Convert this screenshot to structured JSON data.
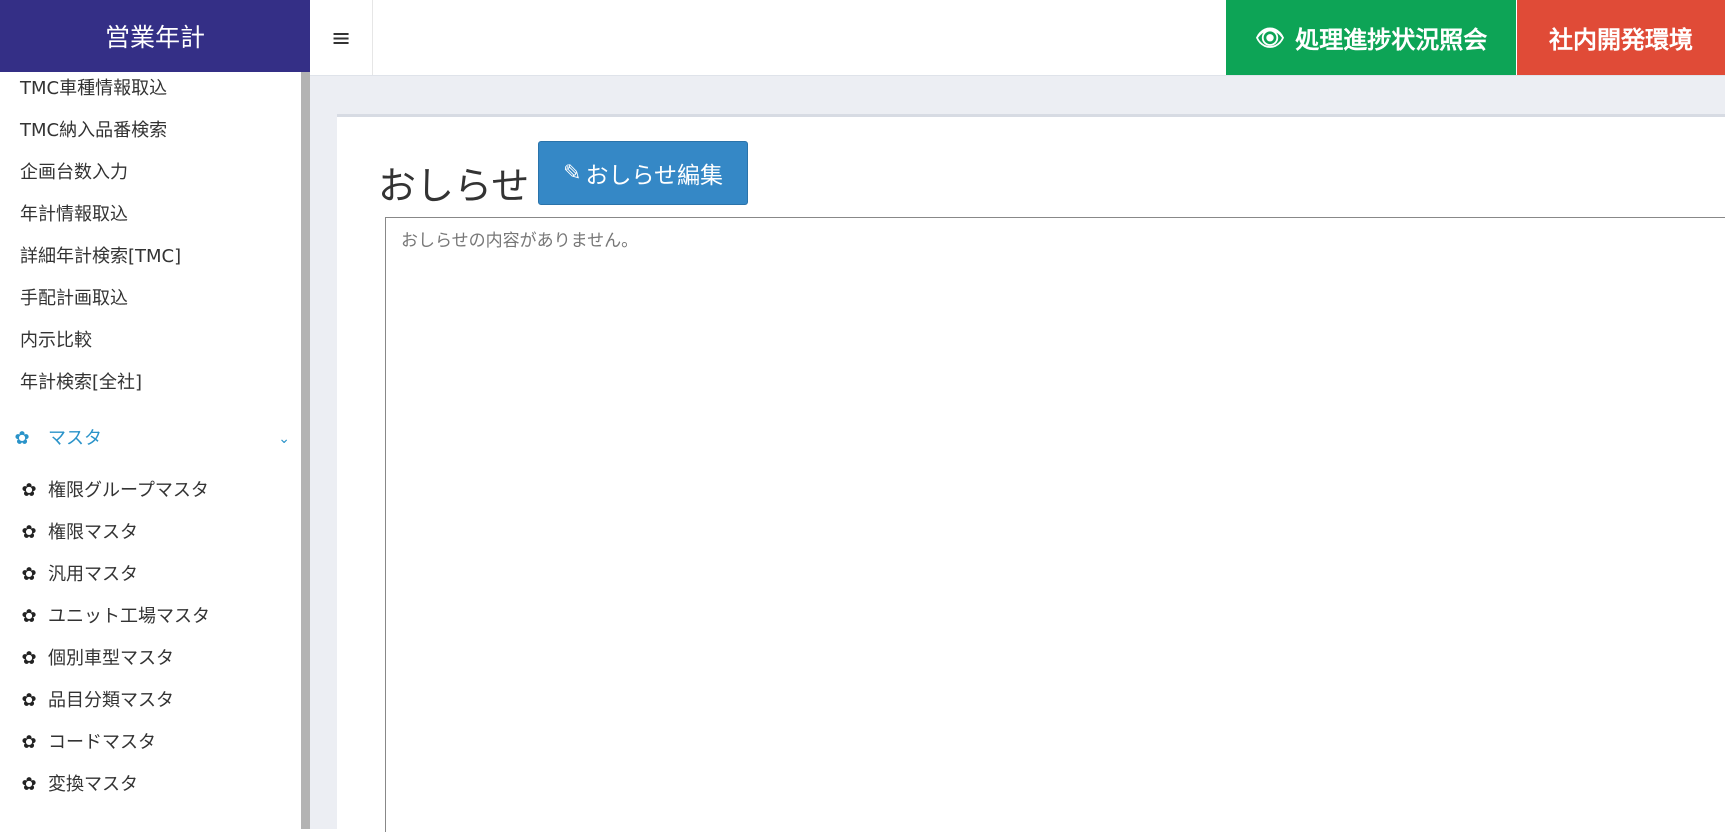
{
  "app": {
    "brand": "営業年計"
  },
  "topbar": {
    "hamburger_icon": "≡",
    "progress_button_label": "処理進捗状況照会",
    "progress_button_icon": "eye-icon",
    "environment_label": "社内開発環境",
    "colors": {
      "progress_button": "#0da456",
      "environment": "#e04b37",
      "brand_bar": "#342f86"
    }
  },
  "sidebar": {
    "items": [
      {
        "label": "TMC車種情報取込"
      },
      {
        "label": "TMC納入品番検索"
      },
      {
        "label": "企画台数入力"
      },
      {
        "label": "年計情報取込"
      },
      {
        "label": "詳細年計検索[TMC]"
      },
      {
        "label": "手配計画取込"
      },
      {
        "label": "内示比較"
      },
      {
        "label": "年計検索[全社]"
      }
    ],
    "master_section": {
      "label": "マスタ",
      "icon": "gear-icon",
      "expanded": true,
      "color": "#2a93c9"
    },
    "master_items": [
      {
        "label": "権限グループマスタ",
        "icon": "gear-icon"
      },
      {
        "label": "権限マスタ",
        "icon": "gear-icon"
      },
      {
        "label": "汎用マスタ",
        "icon": "gear-icon"
      },
      {
        "label": "ユニット工場マスタ",
        "icon": "gear-icon"
      },
      {
        "label": "個別車型マスタ",
        "icon": "gear-icon"
      },
      {
        "label": "品目分類マスタ",
        "icon": "gear-icon"
      },
      {
        "label": "コードマスタ",
        "icon": "gear-icon"
      },
      {
        "label": "変換マスタ",
        "icon": "gear-icon"
      }
    ]
  },
  "main": {
    "title": "おしらせ",
    "edit_button_label": "おしらせ編集",
    "edit_button_icon": "edit-icon",
    "notice_text": "おしらせの内容がありません。"
  }
}
